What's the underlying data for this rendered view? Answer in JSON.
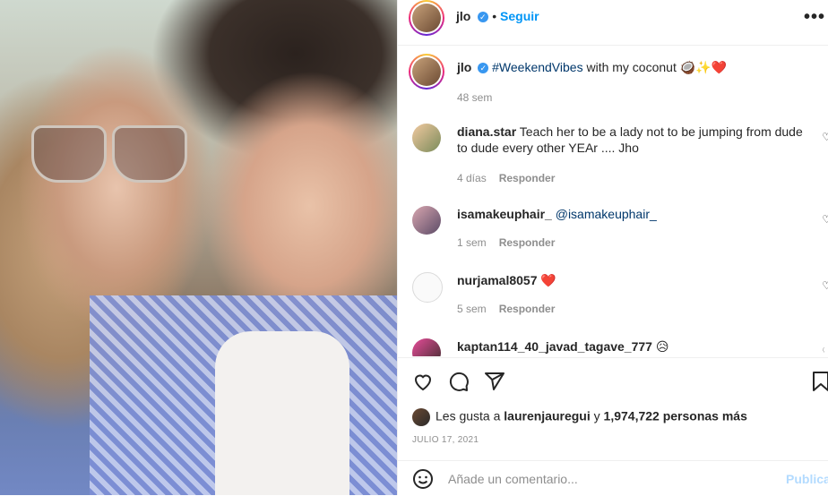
{
  "post": {
    "author": "jlo",
    "follow_label": "Seguir",
    "more_label": "•••",
    "caption_hashtag": "#WeekendVibes",
    "caption_text": " with my coconut 🥥✨❤️",
    "caption_time": "48 sem"
  },
  "comments": [
    {
      "user": "diana.star",
      "text": "Teach her to be a lady not to be jumping from dude to dude every other YEAr .... Jho",
      "time": "4 días",
      "reply": "Responder"
    },
    {
      "user": "isamakeuphair_",
      "text": "@isamakeuphair_",
      "time": "1 sem",
      "reply": "Responder"
    },
    {
      "user": "nurjamal8057",
      "text": "❤️",
      "time": "5 sem",
      "reply": "Responder"
    },
    {
      "user": "kaptan114_40_javad_tagave_777",
      "text": "😥",
      "time": "",
      "reply": ""
    }
  ],
  "likes": {
    "prefix": "Les gusta a ",
    "user": "laurenjauregui",
    "mid": " y ",
    "count": "1,974,722 personas más"
  },
  "date": "JULIO 17, 2021",
  "add_comment": {
    "placeholder": "Añade un comentario...",
    "publish": "Publicar"
  },
  "colors": {
    "link": "#0095f6",
    "hashtag": "#00376b",
    "muted": "#8e8e8e"
  }
}
